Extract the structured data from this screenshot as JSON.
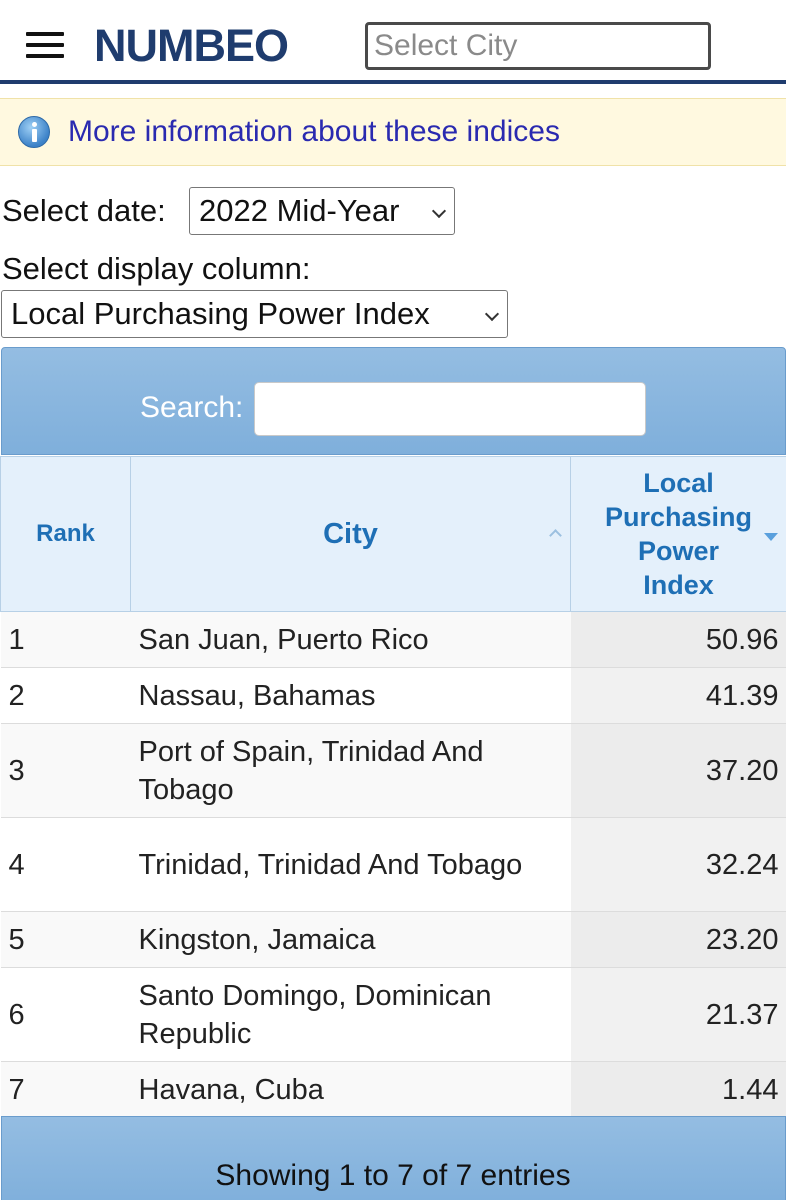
{
  "header": {
    "logo": "NUMBEO",
    "city_placeholder": "Select City"
  },
  "info": {
    "link_text": "More information about these indices"
  },
  "filters": {
    "date_label": "Select date:",
    "date_value": "2022 Mid-Year",
    "column_label": "Select display column:",
    "column_value": "Local Purchasing Power Index"
  },
  "table": {
    "search_label": "Search:",
    "search_value": "",
    "headers": {
      "rank": "Rank",
      "city": "City",
      "index": "Local Purchasing Power Index"
    },
    "rows": [
      {
        "rank": "1",
        "city": "San Juan, Puerto Rico",
        "value": "50.96"
      },
      {
        "rank": "2",
        "city": "Nassau, Bahamas",
        "value": "41.39"
      },
      {
        "rank": "3",
        "city": "Port of Spain, Trinidad And Tobago",
        "value": "37.20"
      },
      {
        "rank": "4",
        "city": "Trinidad, Trinidad And Tobago",
        "value": "32.24"
      },
      {
        "rank": "5",
        "city": "Kingston, Jamaica",
        "value": "23.20"
      },
      {
        "rank": "6",
        "city": "Santo Domingo, Dominican Republic",
        "value": "21.37"
      },
      {
        "rank": "7",
        "city": "Havana, Cuba",
        "value": "1.44"
      }
    ],
    "footer": "Showing 1 to 7 of 7 entries"
  },
  "colors": {
    "brand": "#1f3c6e",
    "header_blue": "#1e6fb5",
    "bar_blue": "#8ab6df",
    "info_bg": "#fff9e0",
    "link": "#2a2ab0"
  }
}
